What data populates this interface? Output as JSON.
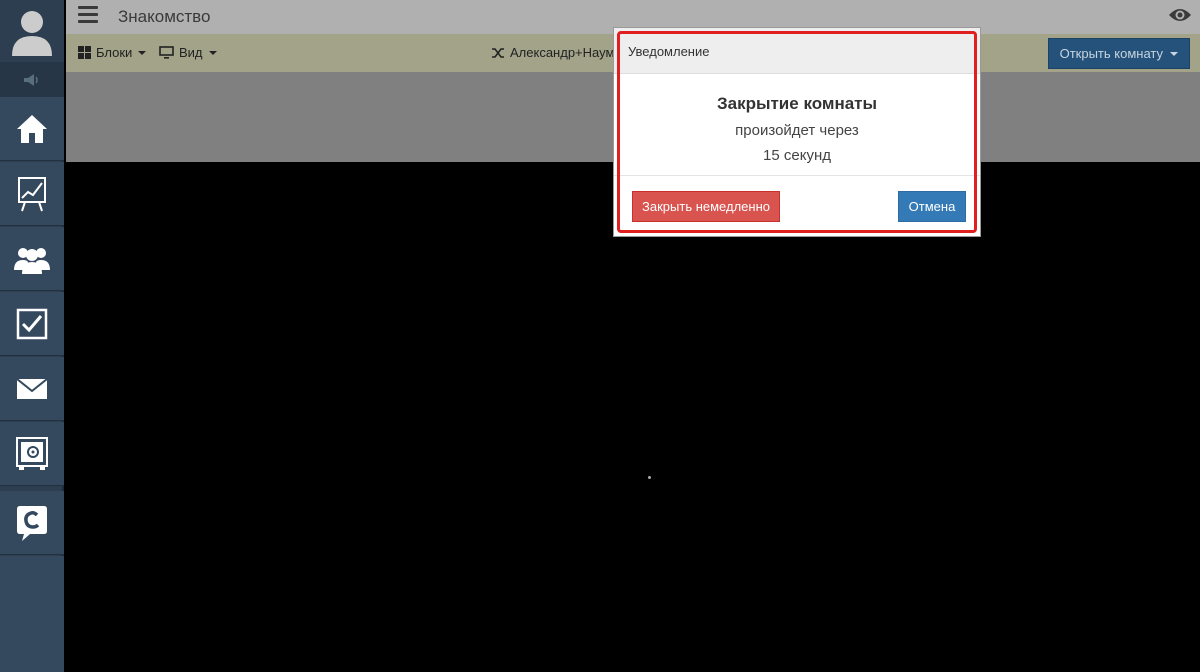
{
  "header": {
    "title": "Знакомство"
  },
  "toolbar": {
    "blocks_label": "Блоки",
    "view_label": "Вид",
    "participants_label": "Александр+Наум",
    "open_room_label": "Открыть комнату"
  },
  "sidebar": {
    "items": [
      {
        "icon": "home-icon"
      },
      {
        "icon": "chart-board-icon"
      },
      {
        "icon": "users-icon"
      },
      {
        "icon": "checkbox-icon"
      },
      {
        "icon": "mail-icon"
      },
      {
        "icon": "safe-icon"
      },
      {
        "icon": "chat-c-icon"
      }
    ]
  },
  "modal": {
    "header": "Уведомление",
    "title": "Закрытие комнаты",
    "line1": "произойдет через",
    "line2": "15 секунд",
    "close_now_label": "Закрыть немедленно",
    "cancel_label": "Отмена"
  },
  "colors": {
    "sidebar": "#34495e",
    "highlight": "#e02020",
    "danger": "#d9534f",
    "primary": "#337ab7"
  }
}
